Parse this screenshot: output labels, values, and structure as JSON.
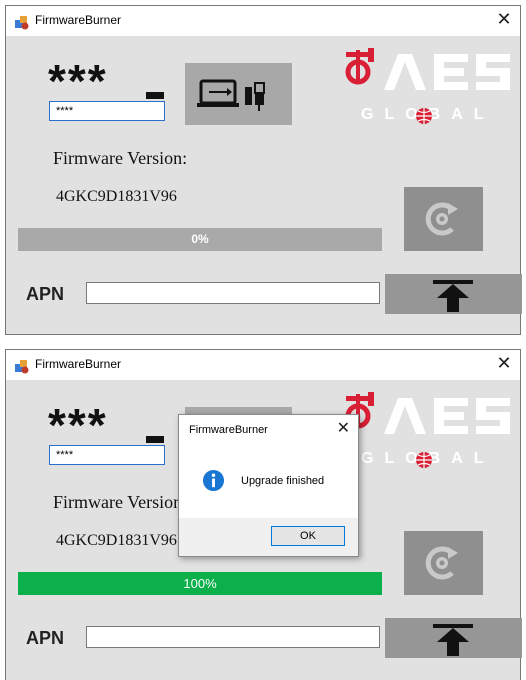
{
  "window1": {
    "title": "FirmwareBurner",
    "close_glyph": "✕",
    "password_mask": "***",
    "password_value": "****",
    "logo_brand": "AES",
    "logo_global": "GLOBAL",
    "firmware_label": "Firmware Version:",
    "firmware_value": "4GKC9D1831V96",
    "progress_percent": 0,
    "progress_text": "0%",
    "apn_label": "APN",
    "apn_value": ""
  },
  "window2": {
    "title": "FirmwareBurner",
    "close_glyph": "✕",
    "password_mask": "***",
    "password_value": "****",
    "logo_brand": "AES",
    "logo_global": "GLOBAL",
    "firmware_label": "Firmware Version:",
    "firmware_value": "4GKC9D1831V96",
    "progress_percent": 100,
    "progress_text": "100%",
    "apn_label": "APN",
    "apn_value": ""
  },
  "dialog": {
    "title": "FirmwareBurner",
    "close_glyph": "✕",
    "message": "Upgrade finished",
    "ok_label": "OK",
    "icon": "info-icon"
  },
  "colors": {
    "progress_fill": "#0bb04a",
    "progress_track": "#a9a9a9",
    "logo_red": "#d81f35",
    "info_blue": "#1976d2"
  }
}
